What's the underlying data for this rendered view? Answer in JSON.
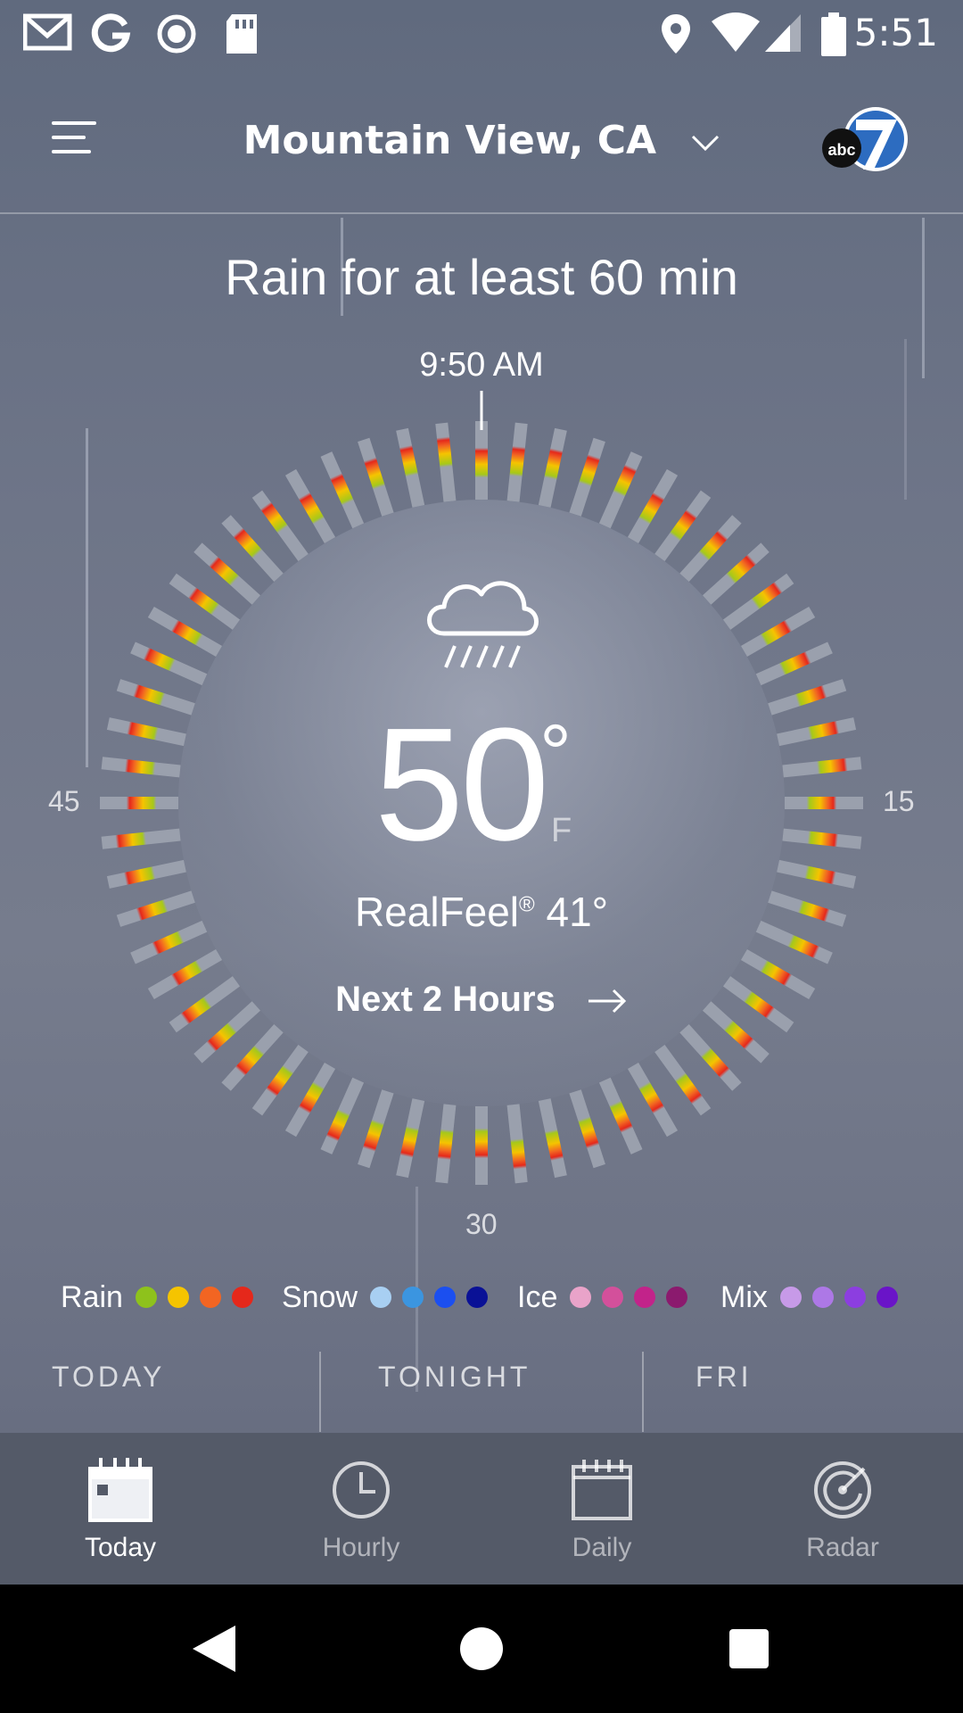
{
  "status_bar": {
    "time": "5:51",
    "left_icons": [
      "gmail-icon",
      "google-icon",
      "record-icon",
      "sd-card-icon"
    ],
    "right_icons": [
      "location-icon",
      "wifi-icon",
      "signal-icon",
      "battery-icon"
    ]
  },
  "header": {
    "location": "Mountain View, CA",
    "brand": "abc7"
  },
  "minutecast": {
    "summary": "Rain for at least 60 min",
    "start_time": "9:50 AM"
  },
  "dial": {
    "labels": {
      "left": "45",
      "right": "15",
      "bottom": "30"
    },
    "marker": "start-time-tick"
  },
  "current": {
    "temperature": "50",
    "degree": "°",
    "unit": "F",
    "realfeel_label": "RealFeel",
    "realfeel_reg": "®",
    "realfeel_value": "41°",
    "next_hours_label": "Next 2 Hours",
    "condition_icon": "cloud-rain-icon"
  },
  "legend": {
    "groups": [
      {
        "label": "Rain",
        "colors": [
          "#8ec21c",
          "#f5c400",
          "#f26522",
          "#e5281b"
        ]
      },
      {
        "label": "Snow",
        "colors": [
          "#a8cff2",
          "#3b95e0",
          "#1b4ff0",
          "#0a1196"
        ]
      },
      {
        "label": "Ice",
        "colors": [
          "#e9a3c9",
          "#d3509b",
          "#c2238a",
          "#8b1a6e"
        ]
      },
      {
        "label": "Mix",
        "colors": [
          "#c79ae8",
          "#ad78e6",
          "#8c3ee0",
          "#6a14c8"
        ]
      }
    ]
  },
  "forecast_tabs": [
    "TODAY",
    "TONIGHT",
    "FRI"
  ],
  "bottom_nav": {
    "items": [
      {
        "label": "Today",
        "icon": "calendar-today-icon",
        "active": true
      },
      {
        "label": "Hourly",
        "icon": "clock-icon",
        "active": false
      },
      {
        "label": "Daily",
        "icon": "calendar-icon",
        "active": false
      },
      {
        "label": "Radar",
        "icon": "radar-icon",
        "active": false
      }
    ]
  },
  "android_nav": [
    "back-icon",
    "home-icon",
    "recents-icon"
  ],
  "colors": {
    "background": "#6e7588",
    "nav_bg": "#545a68",
    "tick_base": "#9aa0ad",
    "tick_green": "#a6c81a",
    "tick_yellow": "#f5c400",
    "tick_orange": "#f26522",
    "tick_red": "#e5281b"
  }
}
